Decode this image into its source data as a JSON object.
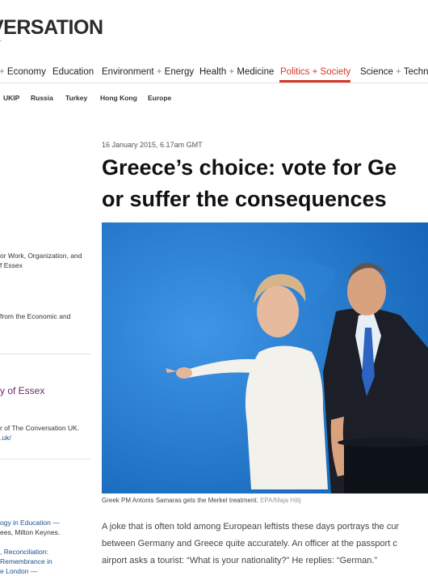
{
  "header": {
    "logo_text": "VERSATION"
  },
  "nav": {
    "items": [
      {
        "label": "+ Economy"
      },
      {
        "label": "Education"
      },
      {
        "label": "Environment + Energy"
      },
      {
        "label": "Health + Medicine"
      },
      {
        "label": "Politics + Society",
        "active": true
      },
      {
        "label": "Science + Techno"
      }
    ]
  },
  "subnav": {
    "items": [
      "UKIP",
      "Russia",
      "Turkey",
      "Hong Kong",
      "Europe"
    ]
  },
  "sidebar": {
    "author_role_line1": "or Work, Organization, and",
    "author_role_line2": "f Essex",
    "funding_line1": "from the Economic and",
    "institution": "y of Essex",
    "partner_line1": "r of The Conversation UK.",
    "partner_line2": ".uk/",
    "related_1_line1": "ogy in Education —",
    "related_1_line2": "ees, Milton Keynes.",
    "related_2_line1": ", Reconciliation:",
    "related_2_line2": "Remembrance in",
    "related_2_line3": "e London —"
  },
  "article": {
    "date": "16 January 2015, 6.17am GMT",
    "headline_line1": "Greece’s choice: vote for Ge",
    "headline_line2": "or suffer the consequences",
    "caption": "Greek PM Antonis Samaras gets the Merkel treatment.",
    "caption_credit": "EPA/Maja Hitij",
    "body_line1": "A joke that is often told among European leftists these days portrays the cur",
    "body_line2": "between Germany and Greece quite accurately. An officer at the passport c",
    "body_line3": "airport asks a tourist: “What is your nationality?” He replies: “German.”"
  },
  "colors": {
    "accent": "#d8352a",
    "photo_background": "#1e73c8",
    "institution": "#6b1f6b"
  }
}
